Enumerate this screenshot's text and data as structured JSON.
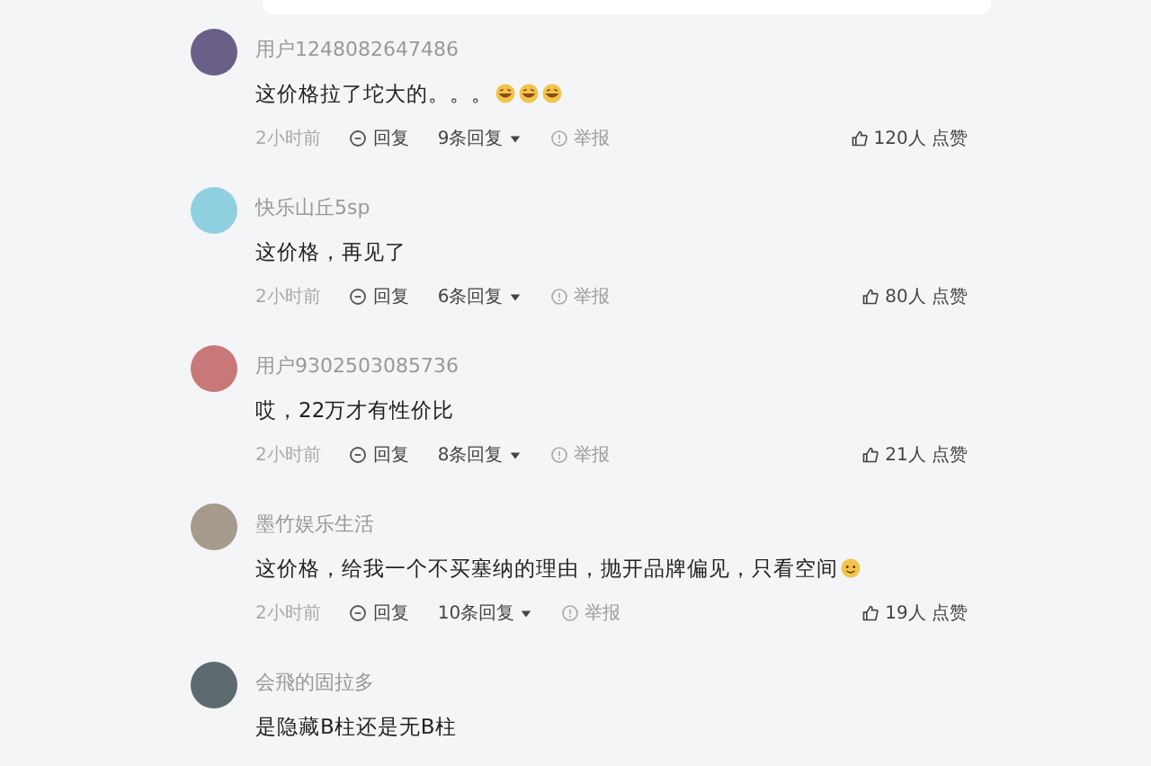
{
  "comments": [
    {
      "user": "用户1248082647486",
      "color": "#6a5f86",
      "text": "这价格拉了坨大的。。。",
      "emojis": [
        {
          "kind": "laugh"
        },
        {
          "kind": "laugh"
        },
        {
          "kind": "laugh"
        }
      ],
      "meta": {
        "time": "2小时前",
        "reply": "回复",
        "replies": "9条回复",
        "report": "举报",
        "likes": "120人 点赞"
      }
    },
    {
      "user": "快乐山丘5sp",
      "color": "#8fd0e0",
      "text": "这价格，再见了",
      "meta": {
        "time": "2小时前",
        "reply": "回复",
        "replies": "6条回复",
        "report": "举报",
        "likes": "80人 点赞"
      }
    },
    {
      "user": "用户9302503085736",
      "color": "#c9787a",
      "text": "哎，22万才有性价比",
      "meta": {
        "time": "2小时前",
        "reply": "回复",
        "replies": "8条回复",
        "report": "举报",
        "likes": "21人 点赞"
      }
    },
    {
      "user": "墨竹娱乐生活",
      "color": "#a59a8c",
      "text": "这价格，给我一个不买塞纳的理由，抛开品牌偏见，只看空间",
      "emojis": [
        {
          "kind": "smile"
        }
      ],
      "meta": {
        "time": "2小时前",
        "reply": "回复",
        "replies": "10条回复",
        "report": "举报",
        "likes": "19人 点赞"
      }
    },
    {
      "user": "会飛的固拉多",
      "color": "#5d6a70",
      "text": "是隐藏B柱还是无B柱"
    }
  ]
}
